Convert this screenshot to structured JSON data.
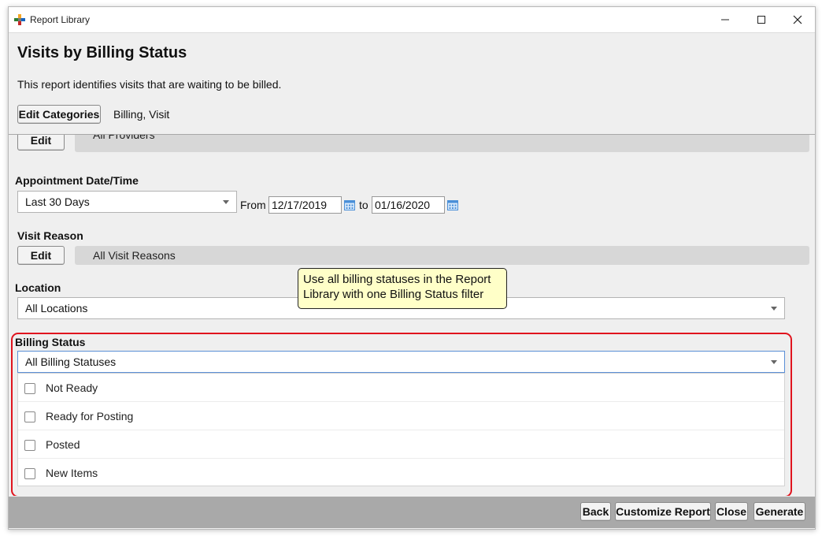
{
  "window": {
    "title": "Report Library",
    "colors": {
      "highlight": "#e0141e",
      "tooltip_bg": "#ffffc8",
      "footer_bg": "#a9a9a9"
    }
  },
  "header": {
    "title": "Visits by Billing Status",
    "description": "This report identifies visits that are waiting to be billed.",
    "edit_categories_label": "Edit Categories",
    "categories": "Billing, Visit"
  },
  "filters": {
    "providers": {
      "edit_label": "Edit",
      "value": "All Providers"
    },
    "appointment": {
      "label": "Appointment Date/Time",
      "range": "Last 30 Days",
      "from_label": "From",
      "from": "12/17/2019",
      "to_label": "to",
      "to": "01/16/2020"
    },
    "visit_reason": {
      "label": "Visit Reason",
      "edit_label": "Edit",
      "value": "All Visit Reasons"
    },
    "location": {
      "label": "Location",
      "value": "All Locations"
    },
    "billing_status": {
      "label": "Billing Status",
      "value": "All Billing Statuses",
      "options": [
        {
          "label": "Not Ready",
          "checked": false
        },
        {
          "label": "Ready for Posting",
          "checked": false
        },
        {
          "label": "Posted",
          "checked": false
        },
        {
          "label": "New Items",
          "checked": false
        }
      ]
    }
  },
  "tooltip": {
    "text": "Use all billing statuses in the Report Library with one Billing Status filter"
  },
  "footer": {
    "back_label": "Back",
    "customize_label": "Customize Report",
    "close_label": "Close",
    "generate_label": "Generate"
  }
}
